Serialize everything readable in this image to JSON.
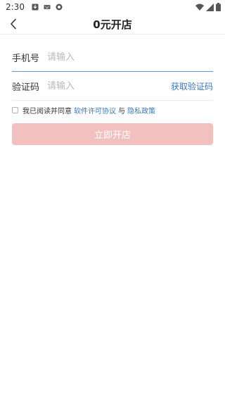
{
  "status_bar": {
    "time": "2:30",
    "notification_icons": [
      "download-notification-icon",
      "keyboard-notification-icon",
      "record-notification-icon"
    ],
    "right_icons": [
      "wifi-icon",
      "cellular-signal-icon",
      "battery-icon"
    ]
  },
  "nav": {
    "title": "0元开店",
    "back_icon": "back-arrow-icon"
  },
  "form": {
    "phone_label": "手机号",
    "phone_placeholder": "请输入",
    "phone_value": "",
    "code_label": "验证码",
    "code_placeholder": "请输入",
    "code_value": "",
    "get_code_label": "获取验证码"
  },
  "agreement": {
    "checked": false,
    "prefix": "我已阅读并同意",
    "license_link": "软件许可协议",
    "conjunction": "与",
    "privacy_link": "隐私政策"
  },
  "submit": {
    "label": "立即开店",
    "color": "#f2c0bf"
  },
  "colors": {
    "link": "#3a78c3",
    "active_underline": "#6c9ad6"
  }
}
